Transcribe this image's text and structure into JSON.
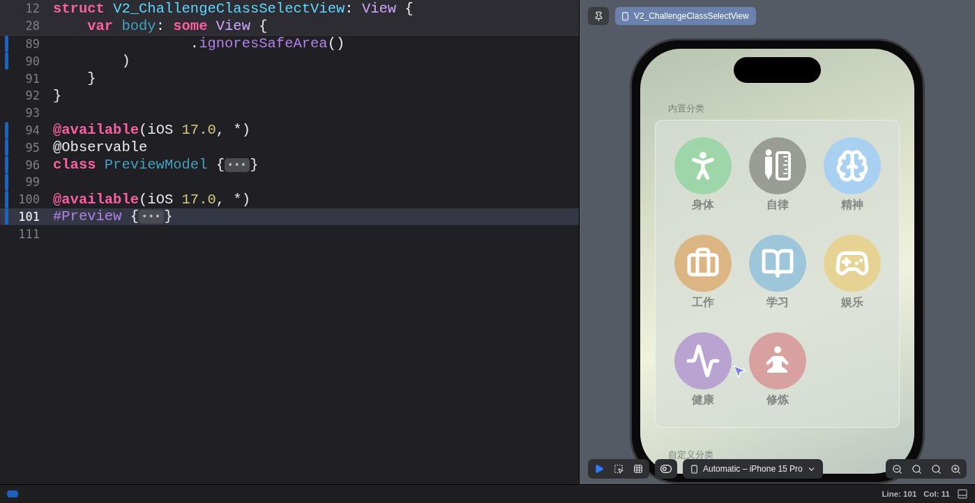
{
  "editor": {
    "lines": [
      {
        "number": "12",
        "sticky": true,
        "selected": false,
        "changed": false,
        "tokens": [
          {
            "kind": "keyword",
            "text": "struct "
          },
          {
            "kind": "decl",
            "text": "V2_ChallengeClassSelectView"
          },
          {
            "kind": "plain",
            "text": ": "
          },
          {
            "kind": "type",
            "text": "View"
          },
          {
            "kind": "plain",
            "text": " {"
          }
        ]
      },
      {
        "number": "28",
        "sticky": true,
        "selected": false,
        "changed": false,
        "tokens": [
          {
            "kind": "keyword",
            "text": "    var "
          },
          {
            "kind": "member",
            "text": "body"
          },
          {
            "kind": "plain",
            "text": ": "
          },
          {
            "kind": "keyword",
            "text": "some "
          },
          {
            "kind": "type",
            "text": "View"
          },
          {
            "kind": "plain",
            "text": " {"
          }
        ]
      },
      {
        "number": "89",
        "sticky": false,
        "selected": false,
        "changed": true,
        "tokens": [
          {
            "kind": "plain",
            "text": "                ."
          },
          {
            "kind": "method",
            "text": "ignoresSafeArea"
          },
          {
            "kind": "plain",
            "text": "()"
          }
        ]
      },
      {
        "number": "90",
        "sticky": false,
        "selected": false,
        "changed": true,
        "tokens": [
          {
            "kind": "plain",
            "text": "        )"
          }
        ]
      },
      {
        "number": "91",
        "sticky": false,
        "selected": false,
        "changed": false,
        "tokens": [
          {
            "kind": "plain",
            "text": "    }"
          }
        ]
      },
      {
        "number": "92",
        "sticky": false,
        "selected": false,
        "changed": false,
        "tokens": [
          {
            "kind": "plain",
            "text": "}"
          }
        ]
      },
      {
        "number": "93",
        "sticky": false,
        "selected": false,
        "changed": false
      },
      {
        "number": "94",
        "sticky": false,
        "selected": false,
        "changed": true,
        "tokens": [
          {
            "kind": "keyword",
            "text": "@available"
          },
          {
            "kind": "plain",
            "text": "(iOS "
          },
          {
            "kind": "number",
            "text": "17.0"
          },
          {
            "kind": "plain",
            "text": ", *)"
          }
        ]
      },
      {
        "number": "95",
        "sticky": false,
        "selected": false,
        "changed": true,
        "tokens": [
          {
            "kind": "plain",
            "text": "@Observable"
          }
        ]
      },
      {
        "number": "96",
        "sticky": false,
        "selected": false,
        "changed": true,
        "tokens": [
          {
            "kind": "keyword",
            "text": "class "
          },
          {
            "kind": "member",
            "text": "PreviewModel"
          },
          {
            "kind": "plain",
            "text": " {"
          },
          {
            "kind": "fold",
            "text": "•••"
          },
          {
            "kind": "plain",
            "text": "}"
          }
        ]
      },
      {
        "number": "99",
        "sticky": false,
        "selected": false,
        "changed": true
      },
      {
        "number": "100",
        "sticky": false,
        "selected": false,
        "changed": true,
        "tokens": [
          {
            "kind": "keyword",
            "text": "@available"
          },
          {
            "kind": "plain",
            "text": "(iOS "
          },
          {
            "kind": "number",
            "text": "17.0"
          },
          {
            "kind": "plain",
            "text": ", *)"
          }
        ]
      },
      {
        "number": "101",
        "sticky": false,
        "selected": true,
        "changed": true,
        "tokens": [
          {
            "kind": "method",
            "text": "#Preview"
          },
          {
            "kind": "plain",
            "text": " {"
          },
          {
            "kind": "fold",
            "text": "•••"
          },
          {
            "kind": "plain",
            "text": "}"
          }
        ]
      },
      {
        "number": "111",
        "sticky": false,
        "selected": false,
        "changed": false
      }
    ]
  },
  "preview": {
    "tab": "V2_ChallengeClassSelectView",
    "screen": {
      "section_title": "内置分类",
      "categories": [
        {
          "name": "身体",
          "color": "#9fd6a9"
        },
        {
          "name": "自律",
          "color": "#9a9d94"
        },
        {
          "name": "精神",
          "color": "#a8d0f0"
        },
        {
          "name": "工作",
          "color": "#dbb683"
        },
        {
          "name": "学习",
          "color": "#9dc6da"
        },
        {
          "name": "娱乐",
          "color": "#e6d394"
        },
        {
          "name": "健康",
          "color": "#b9a3d1"
        },
        {
          "name": "修炼",
          "color": "#d8a19f"
        }
      ],
      "second_section_title": "自定义分类"
    },
    "modes": [
      {
        "selected": true
      },
      {
        "selected": false
      },
      {
        "selected": false
      }
    ],
    "device": "Automatic – iPhone 15 Pro"
  },
  "status_bar": {
    "line": "Line: 101",
    "col": "Col: 11"
  }
}
